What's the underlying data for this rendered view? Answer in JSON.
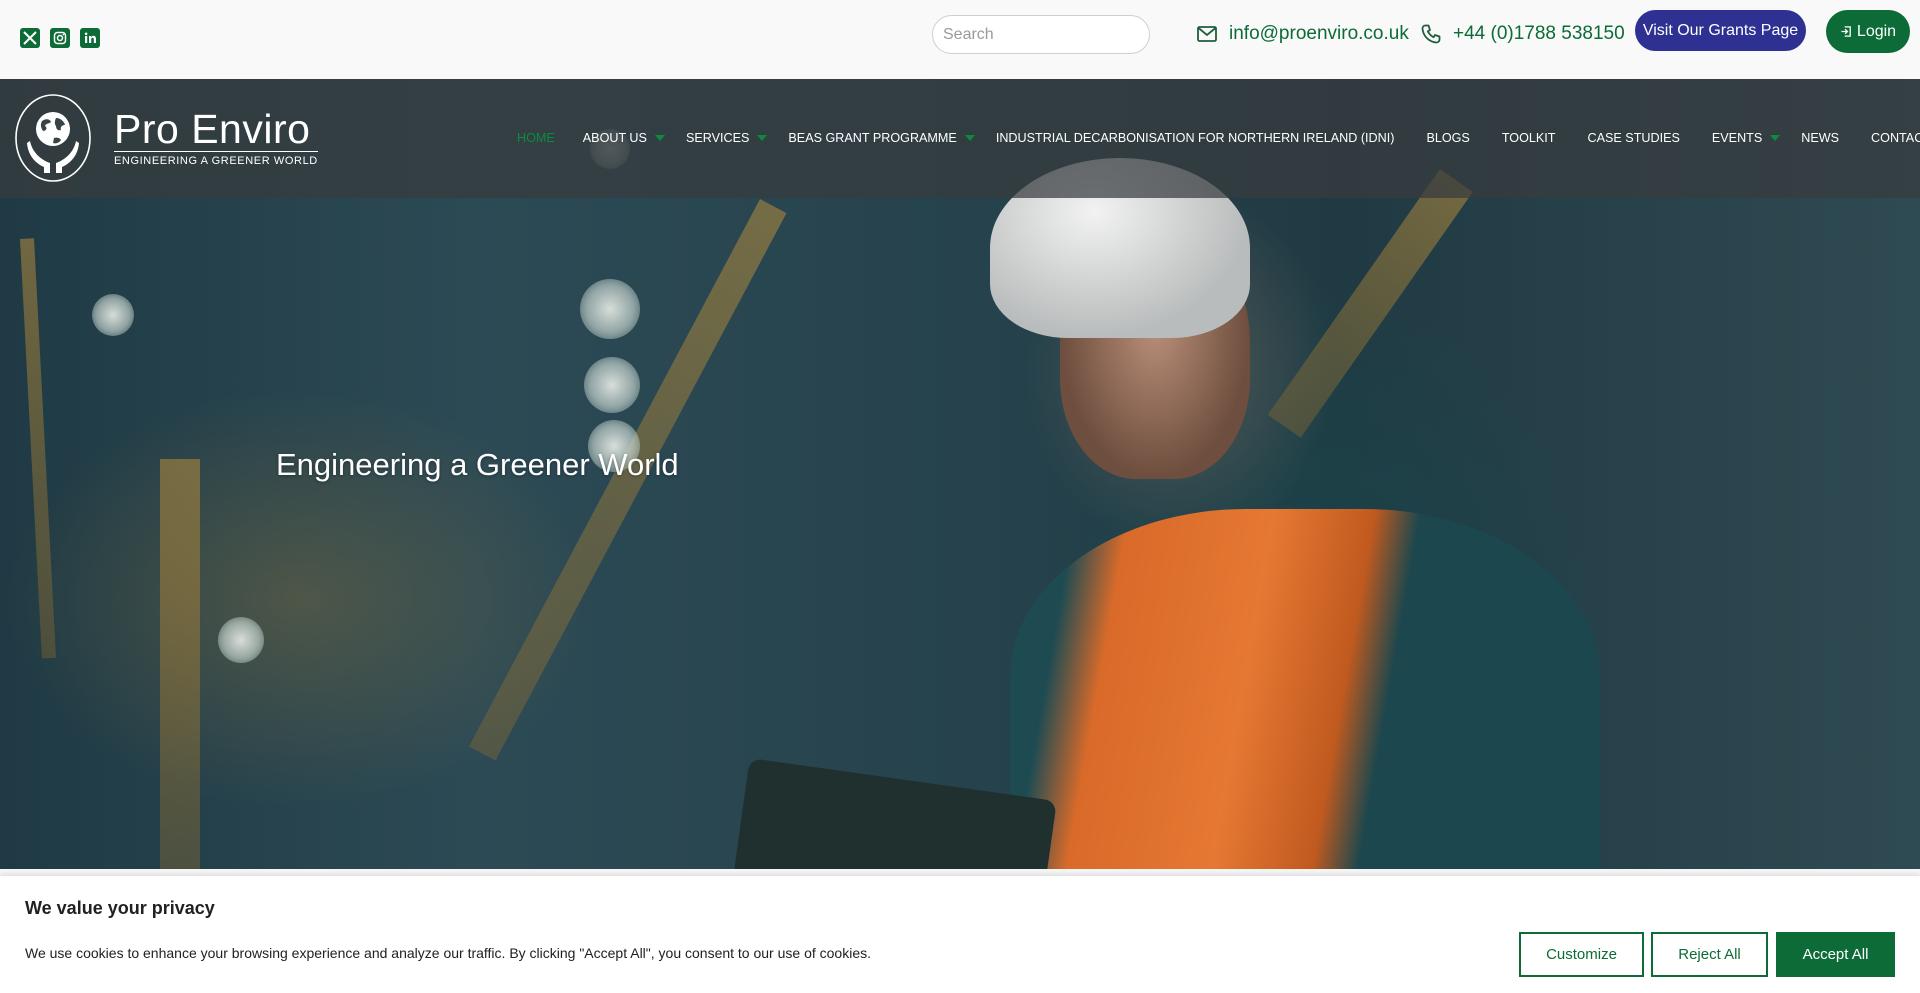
{
  "topbar": {
    "social": [
      {
        "name": "x-icon",
        "label": "X"
      },
      {
        "name": "instagram-icon",
        "label": "Instagram"
      },
      {
        "name": "linkedin-icon",
        "label": "in"
      }
    ],
    "search_placeholder": "Search",
    "email": "info@proenviro.co.uk",
    "phone": "+44 (0)1788 538150",
    "grants_button": "Visit Our Grants Page",
    "login_button": "Login"
  },
  "logo": {
    "name": "Pro Enviro",
    "tagline": "ENGINEERING A GREENER WORLD"
  },
  "nav": {
    "items": [
      {
        "label": "HOME",
        "active": true,
        "dropdown": false
      },
      {
        "label": "ABOUT US",
        "active": false,
        "dropdown": true
      },
      {
        "label": "SERVICES",
        "active": false,
        "dropdown": true
      },
      {
        "label": "BEAS GRANT PROGRAMME",
        "active": false,
        "dropdown": true
      },
      {
        "label": "INDUSTRIAL DECARBONISATION FOR NORTHERN IRELAND (IDNI)",
        "active": false,
        "dropdown": false
      },
      {
        "label": "BLOGS",
        "active": false,
        "dropdown": false
      },
      {
        "label": "TOOLKIT",
        "active": false,
        "dropdown": false
      },
      {
        "label": "CASE STUDIES",
        "active": false,
        "dropdown": false
      },
      {
        "label": "EVENTS",
        "active": false,
        "dropdown": true
      },
      {
        "label": "NEWS",
        "active": false,
        "dropdown": false
      },
      {
        "label": "CONTACT",
        "active": false,
        "dropdown": false
      }
    ]
  },
  "hero": {
    "title": "Engineering a Greener World"
  },
  "cookie": {
    "title": "We value your privacy",
    "text": "We use cookies to enhance your browsing experience and analyze our traffic. By clicking \"Accept All\", you consent to our use of cookies.",
    "customize": "Customize",
    "reject": "Reject All",
    "accept": "Accept All"
  },
  "colors": {
    "brand_green": "#0c6b36",
    "grants_blue": "#2e3192",
    "active_nav": "#0c8a3e"
  }
}
